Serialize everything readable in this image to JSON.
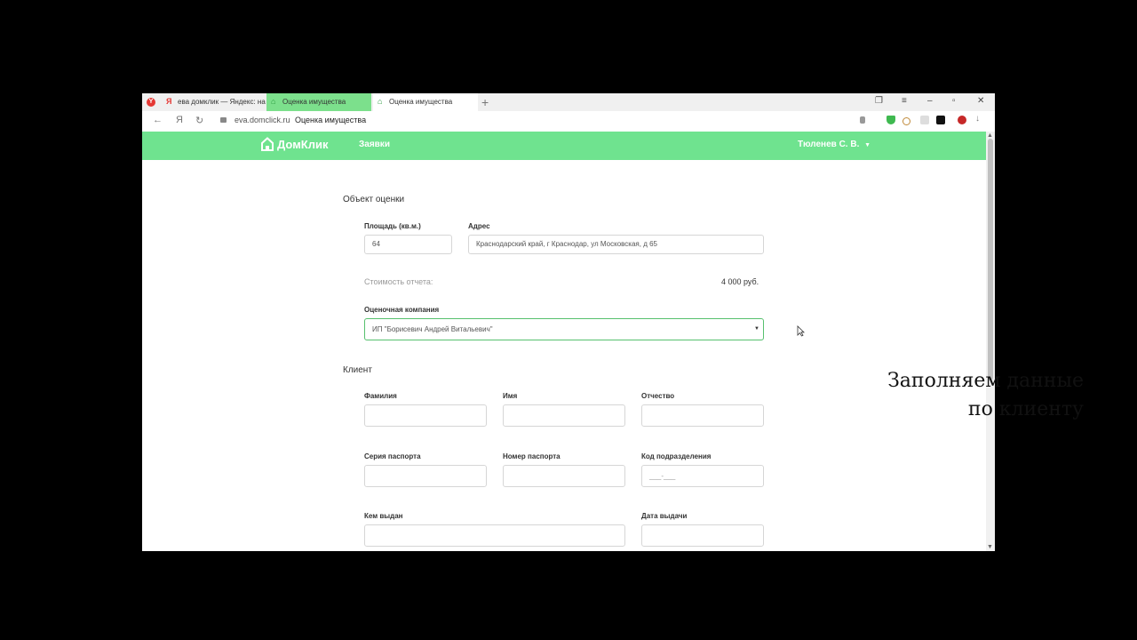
{
  "browser": {
    "tabs": [
      {
        "title": "ева домклик — Яндекс: на"
      },
      {
        "title": "Оценка имущества"
      },
      {
        "title": "Оценка имущества"
      }
    ],
    "new_tab": "+",
    "nav": {
      "back": "←",
      "yandex": "Я",
      "reload": "↻"
    },
    "domain": "eva.domclick.ru",
    "page_title": "Оценка имущества"
  },
  "site": {
    "logo_text": "ДомКлик",
    "nav_link": "Заявки",
    "user": "Тюленев С. В."
  },
  "object": {
    "section_title": "Объект оценки",
    "area_label": "Площадь (кв.м.)",
    "area_value": "64",
    "address_label": "Адрес",
    "address_value": "Краснодарский край, г Краснодар, ул Московская, д 65",
    "cost_label": "Стоимость отчета:",
    "cost_value": "4 000 руб.",
    "company_label": "Оценочная компания",
    "company_value": "ИП \"Борисевич Андрей Витальевич\""
  },
  "client": {
    "section_title": "Клиент",
    "surname_label": "Фамилия",
    "name_label": "Имя",
    "patronymic_label": "Отчество",
    "passport_series_label": "Серия паспорта",
    "passport_number_label": "Номер паспорта",
    "division_code_label": "Код подразделения",
    "division_code_placeholder": "___-___",
    "issued_by_label": "Кем выдан",
    "issue_date_label": "Дата выдачи"
  },
  "caption": {
    "line1": "Заполняем данные",
    "line2": "по клиенту"
  },
  "colors": {
    "header_green": "#6fe38f",
    "active_tab_green": "#7ce08c",
    "select_border": "#57c06e"
  }
}
